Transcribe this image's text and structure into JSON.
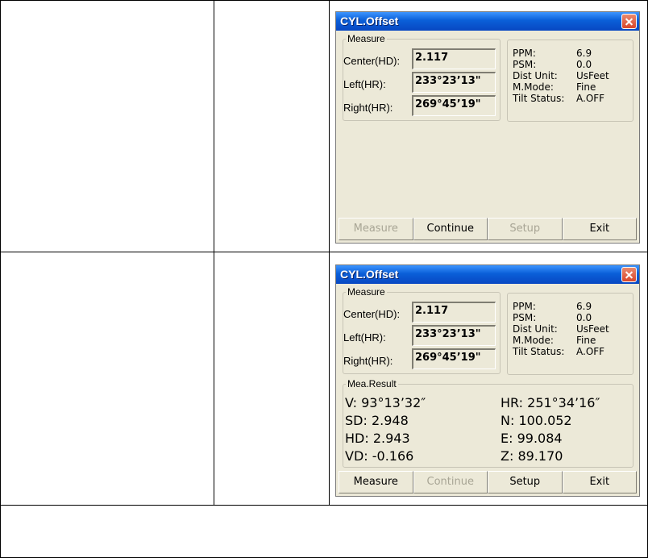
{
  "windows": [
    {
      "title": "CYL.Offset",
      "measure_group": "Measure",
      "fields": [
        {
          "label": "Center(HD):",
          "value": "2.117"
        },
        {
          "label": "Left(HR):",
          "value": "233°23’13\""
        },
        {
          "label": "Right(HR):",
          "value": "269°45’19\""
        }
      ],
      "info": [
        {
          "key": "PPM:",
          "value": "6.9"
        },
        {
          "key": "PSM:",
          "value": "0.0"
        },
        {
          "key": "Dist Unit:",
          "value": "UsFeet"
        },
        {
          "key": "M.Mode:",
          "value": "Fine"
        },
        {
          "key": "Tilt Status:",
          "value": "A.OFF"
        }
      ],
      "buttons": [
        {
          "label": "Measure",
          "enabled": false
        },
        {
          "label": "Continue",
          "enabled": true
        },
        {
          "label": "Setup",
          "enabled": false
        },
        {
          "label": "Exit",
          "enabled": true
        }
      ]
    },
    {
      "title": "CYL.Offset",
      "measure_group": "Measure",
      "fields": [
        {
          "label": "Center(HD):",
          "value": "2.117"
        },
        {
          "label": "Left(HR):",
          "value": "233°23’13\""
        },
        {
          "label": "Right(HR):",
          "value": "269°45’19\""
        }
      ],
      "info": [
        {
          "key": "PPM:",
          "value": "6.9"
        },
        {
          "key": "PSM:",
          "value": "0.0"
        },
        {
          "key": "Dist Unit:",
          "value": "UsFeet"
        },
        {
          "key": "M.Mode:",
          "value": "Fine"
        },
        {
          "key": "Tilt Status:",
          "value": "A.OFF"
        }
      ],
      "result_group": "Mea.Result",
      "results_left": [
        "V:   93°13’32″",
        "SD: 2.948",
        "HD: 2.943",
        "VD: -0.166"
      ],
      "results_right": [
        "HR: 251°34’16″",
        "N: 100.052",
        "E: 99.084",
        "Z: 89.170"
      ],
      "buttons": [
        {
          "label": "Measure",
          "enabled": true
        },
        {
          "label": "Continue",
          "enabled": false
        },
        {
          "label": "Setup",
          "enabled": true
        },
        {
          "label": "Exit",
          "enabled": true
        }
      ]
    }
  ],
  "icons": {
    "close": "close-icon"
  },
  "colors": {
    "titlebar": "#0a5fd8",
    "window_bg": "#ECE9D8",
    "close_button": "#d9462a"
  }
}
